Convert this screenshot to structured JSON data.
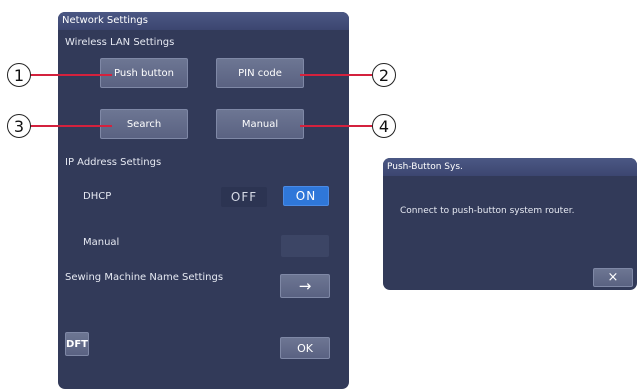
{
  "main": {
    "title": "Network Settings",
    "wireless_heading": "Wireless LAN Settings",
    "buttons": {
      "push_button": "Push button",
      "pin_code": "PIN code",
      "search": "Search",
      "manual": "Manual"
    },
    "ip_heading": "IP Address Settings",
    "dhcp_label": "DHCP",
    "off_label": "OFF",
    "on_label": "ON",
    "manual_label": "Manual",
    "sewing_heading": "Sewing Machine Name Settings",
    "arrow": "→",
    "dft_label": "DFT",
    "ok_label": "OK"
  },
  "callouts": [
    "1",
    "2",
    "3",
    "4"
  ],
  "dialog": {
    "title": "Push-Button Sys.",
    "message": "Connect to push-button system router.",
    "close": "×"
  },
  "colors": {
    "panel": "#323a59",
    "titlebar": "#4b5884",
    "button": "#626a89",
    "on_active": "#2f77d9",
    "leader_line": "#d4213d"
  }
}
